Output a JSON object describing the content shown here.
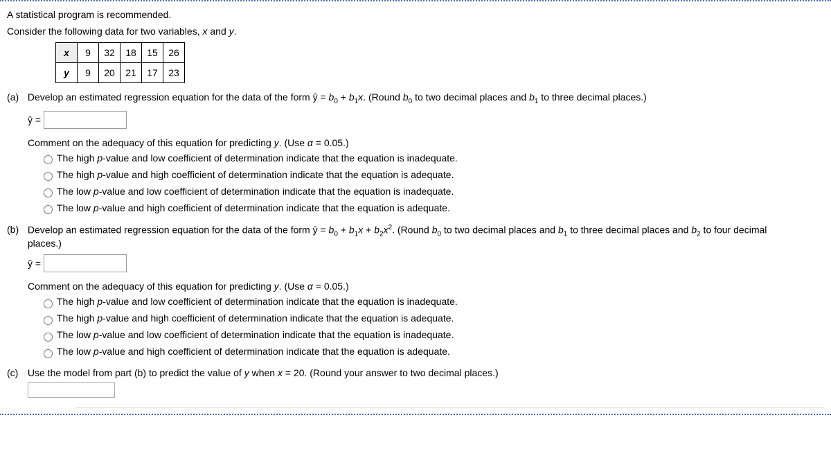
{
  "intro_recommend": "A statistical program is recommended.",
  "intro_consider": "Consider the following data for two variables, ",
  "intro_vars_x": "x",
  "intro_and": " and ",
  "intro_vars_y": "y",
  "intro_period": ".",
  "table": {
    "x_label": "x",
    "y_label": "y",
    "x_vals": [
      "9",
      "32",
      "18",
      "15",
      "26"
    ],
    "y_vals": [
      "9",
      "20",
      "21",
      "17",
      "23"
    ]
  },
  "partA": {
    "label": "(a)",
    "text1": "Develop an estimated regression equation for the data of the form ŷ = ",
    "b0": "b",
    "b0sub": "0",
    "plus": " + ",
    "b1": "b",
    "b1sub": "1",
    "x": "x",
    "round_text1": ". (Round ",
    "round_b0": "b",
    "round_b0sub": "0",
    "round_text2": " to two decimal places and ",
    "round_b1": "b",
    "round_b1sub": "1",
    "round_text3": " to three decimal places.)",
    "yhat_label": "ŷ ="
  },
  "partB": {
    "label": "(b)",
    "text1": "Develop an estimated regression equation for the data of the form ŷ = ",
    "b0": "b",
    "b0sub": "0",
    "plus1": " + ",
    "b1": "b",
    "b1sub": "1",
    "x1": "x",
    "plus2": " + ",
    "b2": "b",
    "b2sub": "2",
    "x2": "x",
    "sq": "2",
    "round_text1": ". (Round ",
    "r_b0": "b",
    "r_b0sub": "0",
    "round_text2": " to two decimal places and ",
    "r_b1": "b",
    "r_b1sub": "1",
    "round_text3": " to three decimal places and ",
    "r_b2": "b",
    "r_b2sub": "2",
    "round_text4": " to four decimal places.)",
    "yhat_label": "ŷ ="
  },
  "comment": {
    "intro1": "Comment on the adequacy of this equation for predicting ",
    "yvar": "y",
    "intro2": ". (Use ",
    "alpha": "α",
    "intro3": " = 0.05.)",
    "opt1a": "The high ",
    "p": "p",
    "opt1b": "-value and low coefficient of determination indicate that the equation is inadequate.",
    "opt2a": "The high ",
    "opt2b": "-value and high coefficient of determination indicate that the equation is adequate.",
    "opt3a": "The low ",
    "opt3b": "-value and low coefficient of determination indicate that the equation is inadequate.",
    "opt4a": "The low ",
    "opt4b": "-value and high coefficient of determination indicate that the equation is adequate."
  },
  "partC": {
    "label": "(c)",
    "text1": "Use the model from part (b) to predict the value of ",
    "y": "y",
    "text2": " when ",
    "x": "x",
    "text3": " = 20. (Round your answer to two decimal places.)"
  }
}
